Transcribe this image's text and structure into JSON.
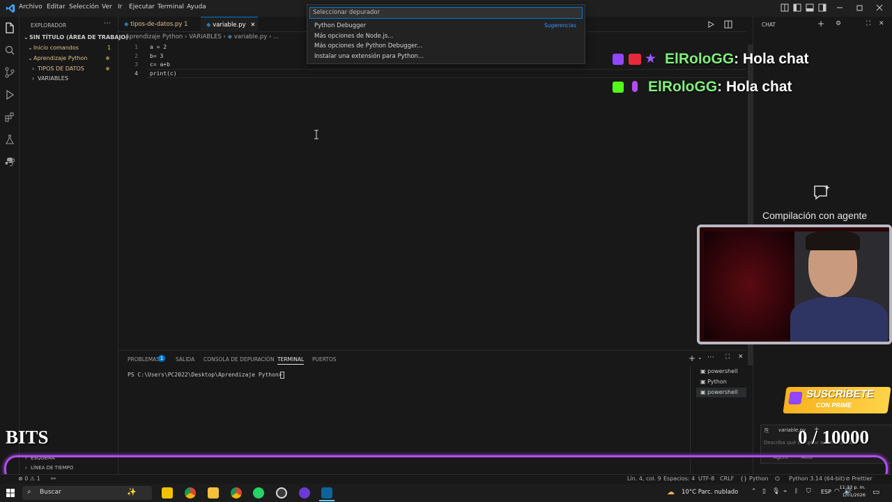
{
  "menu": [
    "Archivo",
    "Editar",
    "Selección",
    "Ver",
    "Ir",
    "Ejecutar",
    "Terminal",
    "Ayuda"
  ],
  "quickpick": {
    "placeholder": "Seleccionar depurador",
    "items": [
      "Python Debugger",
      "Más opciones de Node.js...",
      "Más opciones de Python Debugger...",
      "Instalar una extensión para Python..."
    ],
    "badge": "Sugerencias"
  },
  "explorer": {
    "title": "EXPLORADOR",
    "workspace": "SIN TÍTULO (ÁREA DE TRABAJO)",
    "items": [
      "Inicio comandos",
      "Aprendizaje Python",
      "TIPOS DE DATOS",
      "VARIABLES"
    ],
    "count": "1"
  },
  "tabs": [
    {
      "label": "tipos-de-datos.py",
      "badge": "1"
    },
    {
      "label": "variable.py"
    }
  ],
  "breadcrumb": [
    "Aprendizaje Python",
    "VARIABLES",
    "variable.py",
    "..."
  ],
  "code": {
    "line_numbers": [
      "1",
      "2",
      "3",
      "4"
    ],
    "lines": [
      "a = 2",
      "b= 3",
      "c= a+b",
      "print(c)"
    ]
  },
  "panel": {
    "tabs": [
      "PROBLEMAS",
      "SALIDA",
      "CONSOLA DE DEPURACIÓN",
      "TERMINAL",
      "PUERTOS"
    ],
    "problems_count": "1",
    "prompt": "PS C:\\Users\\PC2022\\Desktop\\Aprendizaje Python>",
    "terminals": [
      "powershell",
      "Python",
      "powershell"
    ]
  },
  "chat": {
    "title": "CHAT",
    "messages": [
      {
        "user": "ElRoloGG",
        "text": ": Hola chat"
      },
      {
        "user": "ElRoloGG",
        "text": ": Hola chat"
      }
    ],
    "agent_label": "Compilación con agente",
    "input_hint": "Describa qué compilar a continuación",
    "file_chip": "variable.py",
    "agent_btn": "Agent",
    "auto_btn": "Auto",
    "subscribe": "SUSCRÍBETE",
    "subscribe_sub": "CON PRIME",
    "goal": "0 / 10000"
  },
  "overlay": {
    "bits": "BITS"
  },
  "outline": [
    "ESQUEMA",
    "LÍNEA DE TIEMPO"
  ],
  "status": {
    "errors": "0",
    "warnings": "1",
    "position": "Lín. 4, col. 9",
    "spaces": "Espacios: 4",
    "encoding": "UTF-8",
    "eol": "CRLF",
    "language": "Python",
    "interpreter": "Python 3.14 (64-bit)",
    "formatter": "Prettier"
  },
  "taskbar": {
    "search": "Buscar",
    "weather": "10°C  Parc. nublado",
    "lang": "ESP",
    "time": "11:33 p. m.",
    "date": "1/01/2026"
  },
  "colors": {
    "accent": "#0078d4",
    "chat_user": "#7ef07a",
    "ring": "#b04df0",
    "folder": "#e2c08d"
  }
}
